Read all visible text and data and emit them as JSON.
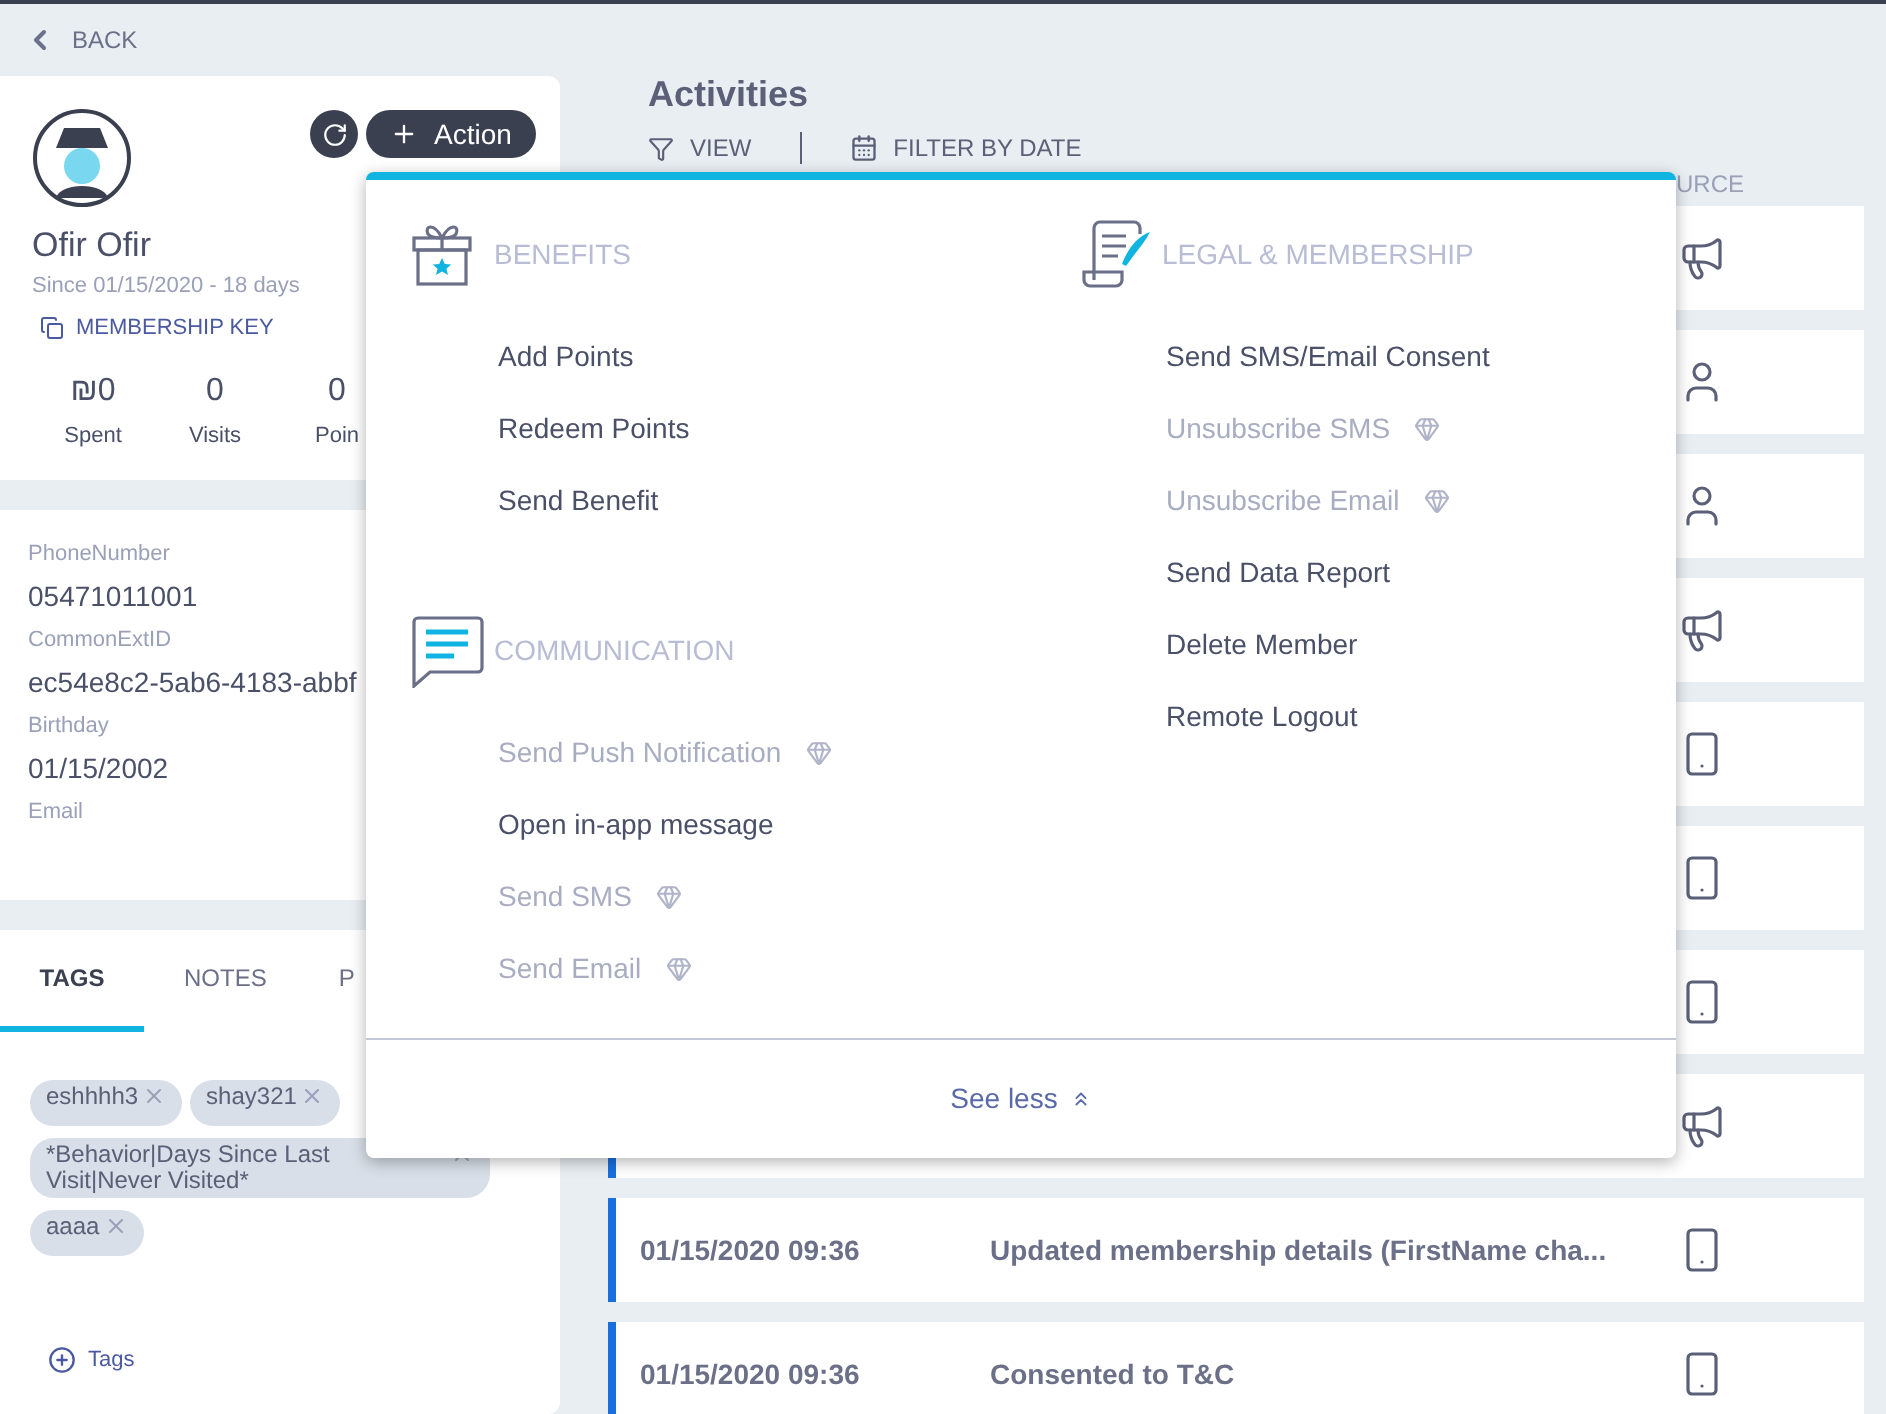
{
  "back": "BACK",
  "profile": {
    "name": "Ofir Ofir",
    "since": "Since 01/15/2020 - 18 days",
    "membership_key": "MEMBERSHIP KEY",
    "action": "Action",
    "stats": [
      {
        "value": "₪0",
        "label": "Spent"
      },
      {
        "value": "0",
        "label": "Visits"
      },
      {
        "value": "0",
        "label": "Poin"
      }
    ]
  },
  "details": [
    {
      "label": "PhoneNumber",
      "value": "05471011001"
    },
    {
      "label": "CommonExtID",
      "value": "ec54e8c2-5ab6-4183-abbf"
    },
    {
      "label": "Birthday",
      "value": "01/15/2002"
    },
    {
      "label": "Email"
    }
  ],
  "tabs": [
    {
      "label": "TAGS",
      "selected": true
    },
    {
      "label": "NOTES",
      "selected": false
    },
    {
      "label": "P",
      "selected": false
    }
  ],
  "tags": [
    "eshhhh3",
    "shay321",
    "*Behavior|Days Since Last Visit|Never Visited*",
    "aaaa"
  ],
  "add_tag": "Tags",
  "activities": {
    "title": "Activities",
    "view": "VIEW",
    "filter": "FILTER BY DATE",
    "column_3": "URCE",
    "rows": [
      {
        "kind": "campaign"
      },
      {
        "kind": "member"
      },
      {
        "kind": "member"
      },
      {
        "kind": "campaign"
      },
      {
        "kind": "app"
      },
      {
        "kind": "app"
      },
      {
        "kind": "app"
      },
      {
        "kind": "campaign"
      },
      {
        "kind": "app",
        "date": "01/15/2020 09:36",
        "description": "Updated membership details (FirstName cha..."
      },
      {
        "kind": "app",
        "date": "01/15/2020 09:36",
        "description": "Consented to T&C"
      }
    ]
  },
  "action_menu": {
    "columns": [
      [
        {
          "kind": "gift",
          "title": "BENEFITS",
          "items": [
            {
              "label": "Add Points",
              "disabled": false
            },
            {
              "label": "Redeem Points",
              "disabled": false
            },
            {
              "label": "Send Benefit",
              "disabled": false
            }
          ]
        },
        {
          "kind": "chat",
          "title": "COMMUNICATION",
          "items": [
            {
              "label": "Send Push Notification",
              "disabled": true
            },
            {
              "label": "Open in-app message",
              "disabled": false
            },
            {
              "label": "Send SMS",
              "disabled": true
            },
            {
              "label": "Send Email",
              "disabled": true
            }
          ]
        }
      ],
      [
        {
          "kind": "scroll",
          "title": "LEGAL & MEMBERSHIP",
          "items": [
            {
              "label": "Send SMS/Email Consent",
              "disabled": false
            },
            {
              "label": "Unsubscribe SMS",
              "disabled": true
            },
            {
              "label": "Unsubscribe Email",
              "disabled": true
            },
            {
              "label": "Send Data Report",
              "disabled": false
            },
            {
              "label": "Delete Member",
              "disabled": false
            },
            {
              "label": "Remote Logout",
              "disabled": false
            }
          ]
        }
      ]
    ],
    "see_less": "See less"
  }
}
